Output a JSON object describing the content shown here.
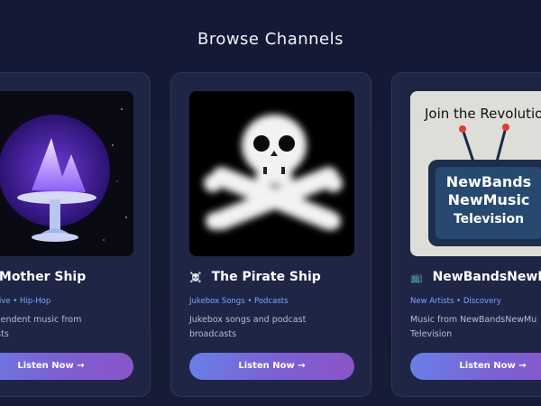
{
  "page": {
    "title": "Browse Channels"
  },
  "channels": [
    {
      "title": "The Mother Ship",
      "tags": "Alternative • Hip-Hop",
      "description_line1": "d independent music from",
      "description_line2": "ng artists",
      "button_label": "Listen Now →",
      "art_icon": "crescent-moon-fountain-art"
    },
    {
      "emoji": "☠️",
      "title": "The Pirate Ship",
      "tags": "Jukebox Songs • Podcasts",
      "description_line1": "Jukebox songs and podcast",
      "description_line2": "broadcasts",
      "button_label": "Listen Now →",
      "art_icon": "skull-crossbones-art"
    },
    {
      "emoji": "📺",
      "title": "NewBandsNewMu",
      "tags": "New Artists • Discovery",
      "description_line1": "Music from NewBandsNewMu",
      "description_line2": "Television",
      "button_label": "Listen Now →",
      "art_icon": "retro-tv-art",
      "art_text": {
        "header": "Join the Revolutio",
        "line1": "NewBands",
        "line2": "NewMusic",
        "line3": "Television"
      }
    }
  ],
  "colors": {
    "background": "#151a35",
    "card": "#1f2545",
    "tag_text": "#7fa3ff",
    "button_start": "#6a7fe6",
    "button_end": "#8a55c9"
  }
}
